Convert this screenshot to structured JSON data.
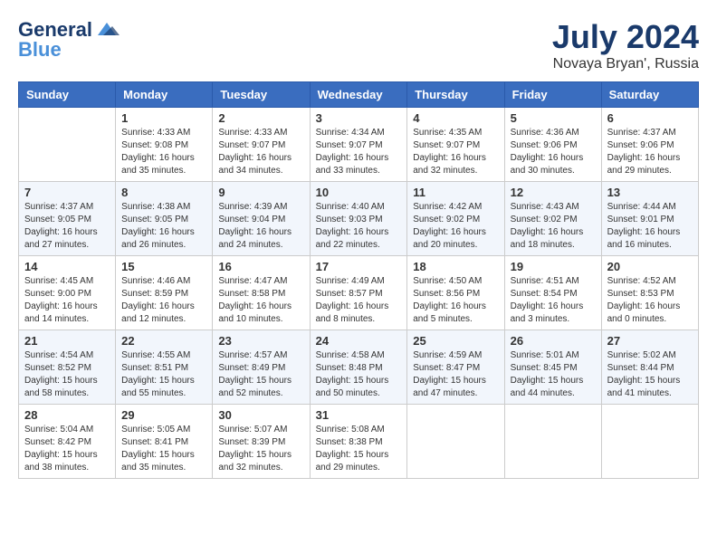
{
  "header": {
    "logo_general": "General",
    "logo_blue": "Blue",
    "month_title": "July 2024",
    "location": "Novaya Bryan', Russia"
  },
  "days_of_week": [
    "Sunday",
    "Monday",
    "Tuesday",
    "Wednesday",
    "Thursday",
    "Friday",
    "Saturday"
  ],
  "weeks": [
    [
      {
        "day": "",
        "sunrise": "",
        "sunset": "",
        "daylight": ""
      },
      {
        "day": "1",
        "sunrise": "Sunrise: 4:33 AM",
        "sunset": "Sunset: 9:08 PM",
        "daylight": "Daylight: 16 hours and 35 minutes."
      },
      {
        "day": "2",
        "sunrise": "Sunrise: 4:33 AM",
        "sunset": "Sunset: 9:07 PM",
        "daylight": "Daylight: 16 hours and 34 minutes."
      },
      {
        "day": "3",
        "sunrise": "Sunrise: 4:34 AM",
        "sunset": "Sunset: 9:07 PM",
        "daylight": "Daylight: 16 hours and 33 minutes."
      },
      {
        "day": "4",
        "sunrise": "Sunrise: 4:35 AM",
        "sunset": "Sunset: 9:07 PM",
        "daylight": "Daylight: 16 hours and 32 minutes."
      },
      {
        "day": "5",
        "sunrise": "Sunrise: 4:36 AM",
        "sunset": "Sunset: 9:06 PM",
        "daylight": "Daylight: 16 hours and 30 minutes."
      },
      {
        "day": "6",
        "sunrise": "Sunrise: 4:37 AM",
        "sunset": "Sunset: 9:06 PM",
        "daylight": "Daylight: 16 hours and 29 minutes."
      }
    ],
    [
      {
        "day": "7",
        "sunrise": "Sunrise: 4:37 AM",
        "sunset": "Sunset: 9:05 PM",
        "daylight": "Daylight: 16 hours and 27 minutes."
      },
      {
        "day": "8",
        "sunrise": "Sunrise: 4:38 AM",
        "sunset": "Sunset: 9:05 PM",
        "daylight": "Daylight: 16 hours and 26 minutes."
      },
      {
        "day": "9",
        "sunrise": "Sunrise: 4:39 AM",
        "sunset": "Sunset: 9:04 PM",
        "daylight": "Daylight: 16 hours and 24 minutes."
      },
      {
        "day": "10",
        "sunrise": "Sunrise: 4:40 AM",
        "sunset": "Sunset: 9:03 PM",
        "daylight": "Daylight: 16 hours and 22 minutes."
      },
      {
        "day": "11",
        "sunrise": "Sunrise: 4:42 AM",
        "sunset": "Sunset: 9:02 PM",
        "daylight": "Daylight: 16 hours and 20 minutes."
      },
      {
        "day": "12",
        "sunrise": "Sunrise: 4:43 AM",
        "sunset": "Sunset: 9:02 PM",
        "daylight": "Daylight: 16 hours and 18 minutes."
      },
      {
        "day": "13",
        "sunrise": "Sunrise: 4:44 AM",
        "sunset": "Sunset: 9:01 PM",
        "daylight": "Daylight: 16 hours and 16 minutes."
      }
    ],
    [
      {
        "day": "14",
        "sunrise": "Sunrise: 4:45 AM",
        "sunset": "Sunset: 9:00 PM",
        "daylight": "Daylight: 16 hours and 14 minutes."
      },
      {
        "day": "15",
        "sunrise": "Sunrise: 4:46 AM",
        "sunset": "Sunset: 8:59 PM",
        "daylight": "Daylight: 16 hours and 12 minutes."
      },
      {
        "day": "16",
        "sunrise": "Sunrise: 4:47 AM",
        "sunset": "Sunset: 8:58 PM",
        "daylight": "Daylight: 16 hours and 10 minutes."
      },
      {
        "day": "17",
        "sunrise": "Sunrise: 4:49 AM",
        "sunset": "Sunset: 8:57 PM",
        "daylight": "Daylight: 16 hours and 8 minutes."
      },
      {
        "day": "18",
        "sunrise": "Sunrise: 4:50 AM",
        "sunset": "Sunset: 8:56 PM",
        "daylight": "Daylight: 16 hours and 5 minutes."
      },
      {
        "day": "19",
        "sunrise": "Sunrise: 4:51 AM",
        "sunset": "Sunset: 8:54 PM",
        "daylight": "Daylight: 16 hours and 3 minutes."
      },
      {
        "day": "20",
        "sunrise": "Sunrise: 4:52 AM",
        "sunset": "Sunset: 8:53 PM",
        "daylight": "Daylight: 16 hours and 0 minutes."
      }
    ],
    [
      {
        "day": "21",
        "sunrise": "Sunrise: 4:54 AM",
        "sunset": "Sunset: 8:52 PM",
        "daylight": "Daylight: 15 hours and 58 minutes."
      },
      {
        "day": "22",
        "sunrise": "Sunrise: 4:55 AM",
        "sunset": "Sunset: 8:51 PM",
        "daylight": "Daylight: 15 hours and 55 minutes."
      },
      {
        "day": "23",
        "sunrise": "Sunrise: 4:57 AM",
        "sunset": "Sunset: 8:49 PM",
        "daylight": "Daylight: 15 hours and 52 minutes."
      },
      {
        "day": "24",
        "sunrise": "Sunrise: 4:58 AM",
        "sunset": "Sunset: 8:48 PM",
        "daylight": "Daylight: 15 hours and 50 minutes."
      },
      {
        "day": "25",
        "sunrise": "Sunrise: 4:59 AM",
        "sunset": "Sunset: 8:47 PM",
        "daylight": "Daylight: 15 hours and 47 minutes."
      },
      {
        "day": "26",
        "sunrise": "Sunrise: 5:01 AM",
        "sunset": "Sunset: 8:45 PM",
        "daylight": "Daylight: 15 hours and 44 minutes."
      },
      {
        "day": "27",
        "sunrise": "Sunrise: 5:02 AM",
        "sunset": "Sunset: 8:44 PM",
        "daylight": "Daylight: 15 hours and 41 minutes."
      }
    ],
    [
      {
        "day": "28",
        "sunrise": "Sunrise: 5:04 AM",
        "sunset": "Sunset: 8:42 PM",
        "daylight": "Daylight: 15 hours and 38 minutes."
      },
      {
        "day": "29",
        "sunrise": "Sunrise: 5:05 AM",
        "sunset": "Sunset: 8:41 PM",
        "daylight": "Daylight: 15 hours and 35 minutes."
      },
      {
        "day": "30",
        "sunrise": "Sunrise: 5:07 AM",
        "sunset": "Sunset: 8:39 PM",
        "daylight": "Daylight: 15 hours and 32 minutes."
      },
      {
        "day": "31",
        "sunrise": "Sunrise: 5:08 AM",
        "sunset": "Sunset: 8:38 PM",
        "daylight": "Daylight: 15 hours and 29 minutes."
      },
      {
        "day": "",
        "sunrise": "",
        "sunset": "",
        "daylight": ""
      },
      {
        "day": "",
        "sunrise": "",
        "sunset": "",
        "daylight": ""
      },
      {
        "day": "",
        "sunrise": "",
        "sunset": "",
        "daylight": ""
      }
    ]
  ]
}
